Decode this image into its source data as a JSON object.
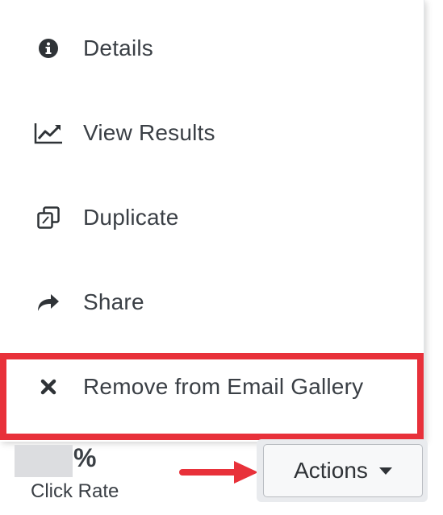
{
  "menu": {
    "items": [
      {
        "label": "Details",
        "icon": "info-circle-icon"
      },
      {
        "label": "View Results",
        "icon": "line-chart-icon"
      },
      {
        "label": "Duplicate",
        "icon": "duplicate-icon"
      },
      {
        "label": "Share",
        "icon": "share-arrow-icon"
      },
      {
        "label": "Remove from Email Gallery",
        "icon": "close-x-icon"
      }
    ],
    "highlighted_item": "Remove from Email Gallery"
  },
  "stats": {
    "click_rate_suffix": "%",
    "click_rate_label": "Click Rate"
  },
  "actions_button": {
    "label": "Actions",
    "icon": "caret-down-icon"
  },
  "colors": {
    "highlight": "#e8313a",
    "text": "#3a3f45"
  }
}
